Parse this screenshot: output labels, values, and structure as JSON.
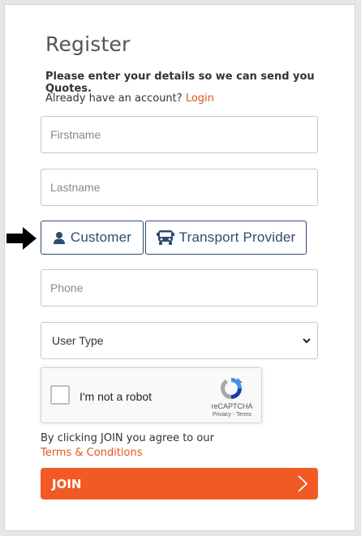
{
  "form": {
    "title": "Register",
    "subtitle": "Please enter your details so we can send you Quotes.",
    "account_prompt": "Already have an account?",
    "login_link": "Login",
    "firstname_placeholder": "Firstname",
    "lastname_placeholder": "Lastname",
    "phone_placeholder": "Phone",
    "user_type_selected": "User Type",
    "roles": {
      "customer_label": "Customer",
      "transport_label": "Transport Provider"
    },
    "recaptcha": {
      "checkbox_label": "I'm not a robot",
      "brand": "reCAPTCHA",
      "links": "Privacy - Terms"
    },
    "agree_text": "By clicking JOIN you agree to our",
    "terms_link": "Terms & Conditions",
    "join_label": "JOIN"
  },
  "icons": {
    "arrow": "right-arrow-icon",
    "customer": "person-icon",
    "transport": "bus-icon",
    "select": "chevron-down-icon",
    "recaptcha": "recaptcha-logo-icon",
    "join": "chevron-right-icon"
  },
  "colors": {
    "accent": "#f15a24",
    "link": "#e2551f",
    "role_button": "#2c4d70",
    "title": "#555555"
  }
}
